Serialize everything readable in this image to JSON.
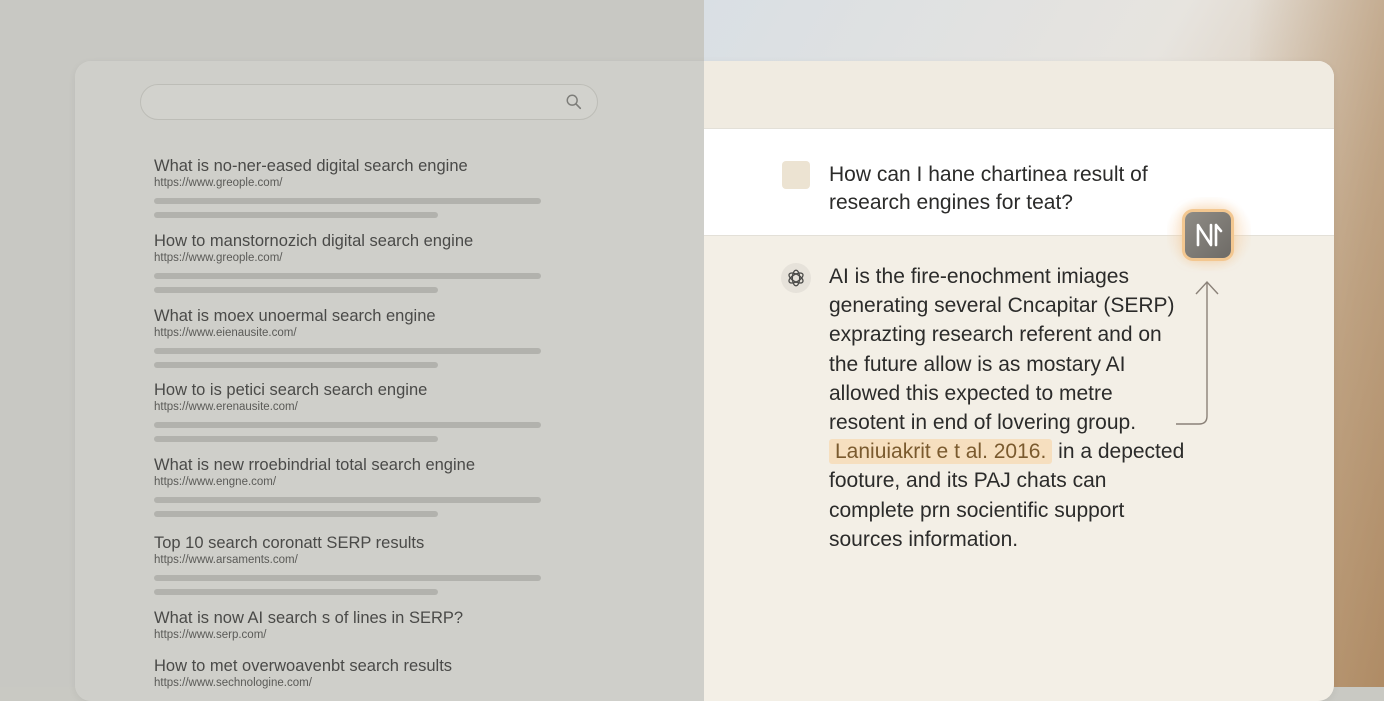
{
  "search": {
    "value": "",
    "placeholder": ""
  },
  "results": [
    {
      "title": "What is no-ner-eased digital search engine",
      "url": "https://www.greople.com/"
    },
    {
      "title": "How to manstornozich digital search engine",
      "url": "https://www.greople.com/"
    },
    {
      "title": "What is moex unoermal search engine",
      "url": "https://www.eienausite.com/"
    },
    {
      "title": "How to is petici search search engine",
      "url": "https://www.erenausite.com/"
    },
    {
      "title": "What is new rroebindrial total search engine",
      "url": "https://www.engne.com/"
    },
    {
      "title": "Top 10 search coronatt SERP results",
      "url": "https://www.arsaments.com/"
    },
    {
      "title": "What is now AI search s of lines in SERP?",
      "url": "https://www.serp.com/"
    },
    {
      "title": "How to met overwoavenbt search results",
      "url": "https://www.sechnologine.com/"
    }
  ],
  "question": {
    "text": "How can I hane chartinea result of research engines for teat?"
  },
  "answer": {
    "text_before": "AI is the fire-enochment imiages generating several Cncapitar (SERP) exprazting research referent and on the future allow is as mostary AI allowed this expected to metre resotent in end of lovering group. ",
    "citation": "Laniuiakrit e t al. 2016.",
    "text_after": " in a depected footure, and its PAJ chats can complete prn socientific support sources information."
  },
  "icons": {
    "search": "search-icon",
    "question": "user-square-icon",
    "answer": "openai-logo-icon",
    "badge": "brand-logo-icon",
    "arrow": "arrow-up-icon"
  },
  "colors": {
    "citation_bg": "#f6dfbf",
    "badge_glow": "#f3c790",
    "left_pane": "#cfcfca",
    "right_pane": "#f3efe6"
  }
}
